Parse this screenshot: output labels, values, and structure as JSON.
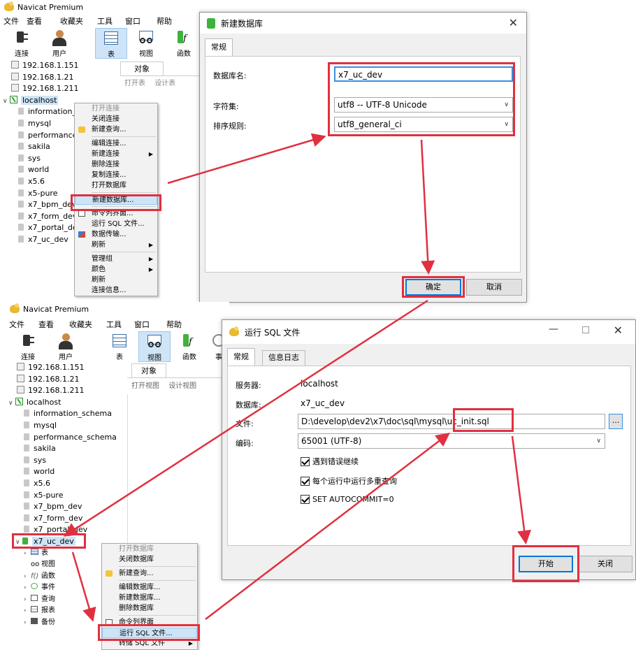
{
  "app": {
    "title": "Navicat Premium",
    "menu": [
      "文件",
      "查看",
      "收藏夹",
      "工具",
      "窗口",
      "帮助"
    ],
    "toolbar": {
      "connect": "连接",
      "user": "用户",
      "table": "表",
      "view": "视图",
      "func": "函数",
      "event_short": "事"
    },
    "object_tab": "对象"
  },
  "top": {
    "connections": [
      "192.168.1.151",
      "192.168.1.21",
      "192.168.1.211",
      "localhost"
    ],
    "databases": [
      "information_",
      "mysql",
      "performance",
      "sakila",
      "sys",
      "world",
      "x5.6",
      "x5-pure",
      "x7_bpm_dev",
      "x7_form_dev",
      "x7_portal_de",
      "x7_uc_dev"
    ],
    "object_toolbar": [
      "打开表",
      "设计表"
    ],
    "context_menu": [
      "打开连接",
      "关闭连接",
      "新建查询...",
      "编辑连接...",
      "新建连接",
      "删除连接",
      "复制连接...",
      "打开数据库",
      "新建数据库...",
      "命令列界面...",
      "运行 SQL 文件...",
      "数据传输...",
      "刷新",
      "管理组",
      "颜色",
      "刷新",
      "连接信息..."
    ]
  },
  "newdb_dialog": {
    "title": "新建数据库",
    "tab": "常规",
    "name_label": "数据库名:",
    "name_value": "x7_uc_dev",
    "charset_label": "字符集:",
    "charset_value": "utf8 -- UTF-8 Unicode",
    "collation_label": "排序规则:",
    "collation_value": "utf8_general_ci",
    "ok": "确定",
    "cancel": "取消"
  },
  "bottom": {
    "connections": [
      "192.168.1.151",
      "192.168.1.21",
      "192.168.1.211",
      "localhost"
    ],
    "databases": [
      "information_schema",
      "mysql",
      "performance_schema",
      "sakila",
      "sys",
      "world",
      "x5.6",
      "x5-pure",
      "x7_bpm_dev",
      "x7_form_dev",
      "x7_portal_dev",
      "x7_uc_dev"
    ],
    "db_children": [
      "表",
      "视图",
      "函数",
      "事件",
      "查询",
      "报表",
      "备份"
    ],
    "object_toolbar": [
      "打开视图",
      "设计视图"
    ],
    "context_menu": [
      "打开数据库",
      "关闭数据库",
      "新建查询...",
      "编辑数据库...",
      "新建数据库...",
      "删除数据库",
      "命令列界面",
      "运行 SQL 文件...",
      "转储 SQL 文件"
    ]
  },
  "runsql_dialog": {
    "title": "运行 SQL 文件",
    "tabs": [
      "常规",
      "信息日志"
    ],
    "server_label": "服务器:",
    "server_value": "localhost",
    "db_label": "数据库:",
    "db_value": "x7_uc_dev",
    "file_label": "文件:",
    "file_value": "D:\\develop\\dev2\\x7\\doc\\sql\\mysql\\uc_init.sql",
    "browse": "...",
    "encoding_label": "编码:",
    "encoding_value": "65001 (UTF-8)",
    "opt1": "遇到错误继续",
    "opt2": "每个运行中运行多重查询",
    "opt3": "SET AUTOCOMMIT=0",
    "start": "开始",
    "close": "关闭"
  },
  "colors": {
    "annotation_red": "#e03040",
    "selection_blue": "#cce4f7",
    "focus_blue": "#0078d7"
  }
}
